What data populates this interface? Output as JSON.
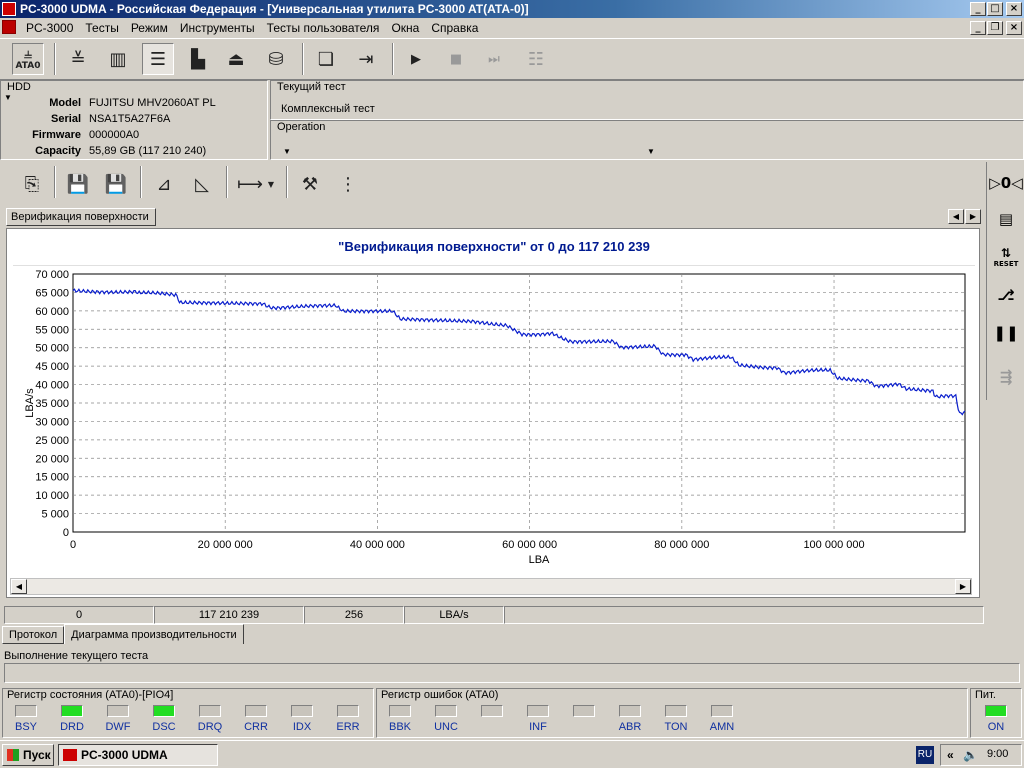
{
  "window": {
    "title": "PC-3000 UDMA - Российская Федерация - [Универсальная утилита PC-3000 AT(ATA-0)]"
  },
  "menu": {
    "items": [
      "PC-3000",
      "Тесты",
      "Режим",
      "Инструменты",
      "Тесты пользователя",
      "Окна",
      "Справка"
    ]
  },
  "toolbar": {
    "ata_label": "ATA0"
  },
  "hdd": {
    "caption": "HDD",
    "fields": [
      {
        "key": "Model",
        "value": "FUJITSU MHV2060AT PL"
      },
      {
        "key": "Serial",
        "value": "NSA1T5A27F6A"
      },
      {
        "key": "Firmware",
        "value": "000000A0"
      },
      {
        "key": "Capacity",
        "value": "55,89 GB (117 210 240)"
      }
    ]
  },
  "current_test": {
    "caption": "Текущий тест",
    "value": "Комплексный тест"
  },
  "operation": {
    "caption": "Operation"
  },
  "rightbar": {
    "reset_label": "RESET"
  },
  "doc_tab": {
    "label": "Верификация поверхности"
  },
  "chart_data": {
    "type": "line",
    "title": "\"Верификация поверхности\" от 0 до 117 210 239",
    "xlabel": "LBA",
    "ylabel": "LBA/s",
    "xlim": [
      0,
      117210239
    ],
    "ylim": [
      0,
      70000
    ],
    "x_ticks": [
      0,
      20000000,
      40000000,
      60000000,
      80000000,
      100000000
    ],
    "x_tick_labels": [
      "0",
      "20 000 000",
      "40 000 000",
      "60 000 000",
      "80 000 000",
      "100 000 000"
    ],
    "y_ticks": [
      0,
      5000,
      10000,
      15000,
      20000,
      25000,
      30000,
      35000,
      40000,
      45000,
      50000,
      55000,
      60000,
      65000,
      70000
    ],
    "y_tick_labels": [
      "0",
      "5 000",
      "10 000",
      "15 000",
      "20 000",
      "25 000",
      "30 000",
      "35 000",
      "40 000",
      "45 000",
      "50 000",
      "55 000",
      "60 000",
      "65 000",
      "70 000"
    ],
    "grid": true,
    "series": [
      {
        "color": "#0a1ecc",
        "x": [
          0,
          8000000,
          8500000,
          13500000,
          14000000,
          25000000,
          26500000,
          34500000,
          35500000,
          42000000,
          43000000,
          52500000,
          55000000,
          57000000,
          59000000,
          63000000,
          65500000,
          71000000,
          72000000,
          76500000,
          77500000,
          80500000,
          81500000,
          86500000,
          87500000,
          92500000,
          93500000,
          99500000,
          100500000,
          104500000,
          105500000,
          108500000,
          109500000,
          113000000,
          113500000,
          116000000,
          116500000,
          117210239
        ],
        "y": [
          65500,
          65500,
          64500,
          64500,
          62000,
          62000,
          61000,
          61000,
          59500,
          59500,
          57500,
          57500,
          56000,
          56000,
          54000,
          54000,
          52000,
          52000,
          50500,
          50500,
          48500,
          48500,
          47000,
          47000,
          45000,
          45000,
          43500,
          43500,
          41500,
          41500,
          40000,
          40000,
          38500,
          38500,
          36500,
          36500,
          32500,
          32000
        ]
      }
    ]
  },
  "status": {
    "cells": [
      "0",
      "117 210 239",
      "256",
      "LBA/s"
    ]
  },
  "bottom_tabs": [
    "Протокол",
    "Диаграмма производительности"
  ],
  "progress": {
    "label": "Выполнение текущего теста",
    "fraction": 0
  },
  "status_register": {
    "caption": "Регистр состояния (ATA0)-[PIO4]",
    "bits": [
      {
        "label": "BSY",
        "on": false
      },
      {
        "label": "DRD",
        "on": true
      },
      {
        "label": "DWF",
        "on": false
      },
      {
        "label": "DSC",
        "on": true
      },
      {
        "label": "DRQ",
        "on": false
      },
      {
        "label": "CRR",
        "on": false
      },
      {
        "label": "IDX",
        "on": false
      },
      {
        "label": "ERR",
        "on": false
      }
    ]
  },
  "error_register": {
    "caption": "Регистр ошибок (ATA0)",
    "bits": [
      {
        "label": "BBK",
        "on": false
      },
      {
        "label": "UNC",
        "on": false
      },
      {
        "label": "",
        "on": false
      },
      {
        "label": "INF",
        "on": false
      },
      {
        "label": "",
        "on": false
      },
      {
        "label": "ABR",
        "on": false
      },
      {
        "label": "TON",
        "on": false
      },
      {
        "label": "AMN",
        "on": false
      }
    ]
  },
  "power": {
    "caption": "Пит.",
    "label": "ON",
    "on": true
  },
  "taskbar": {
    "start_label": "Пуск",
    "app_label": "PC-3000 UDMA",
    "lang": "RU",
    "time": "9:00"
  },
  "colors": {
    "accent": "#0a246a",
    "led_on": "#22dd22",
    "chart_line": "#0a1ecc",
    "chart_title": "#001a90"
  }
}
